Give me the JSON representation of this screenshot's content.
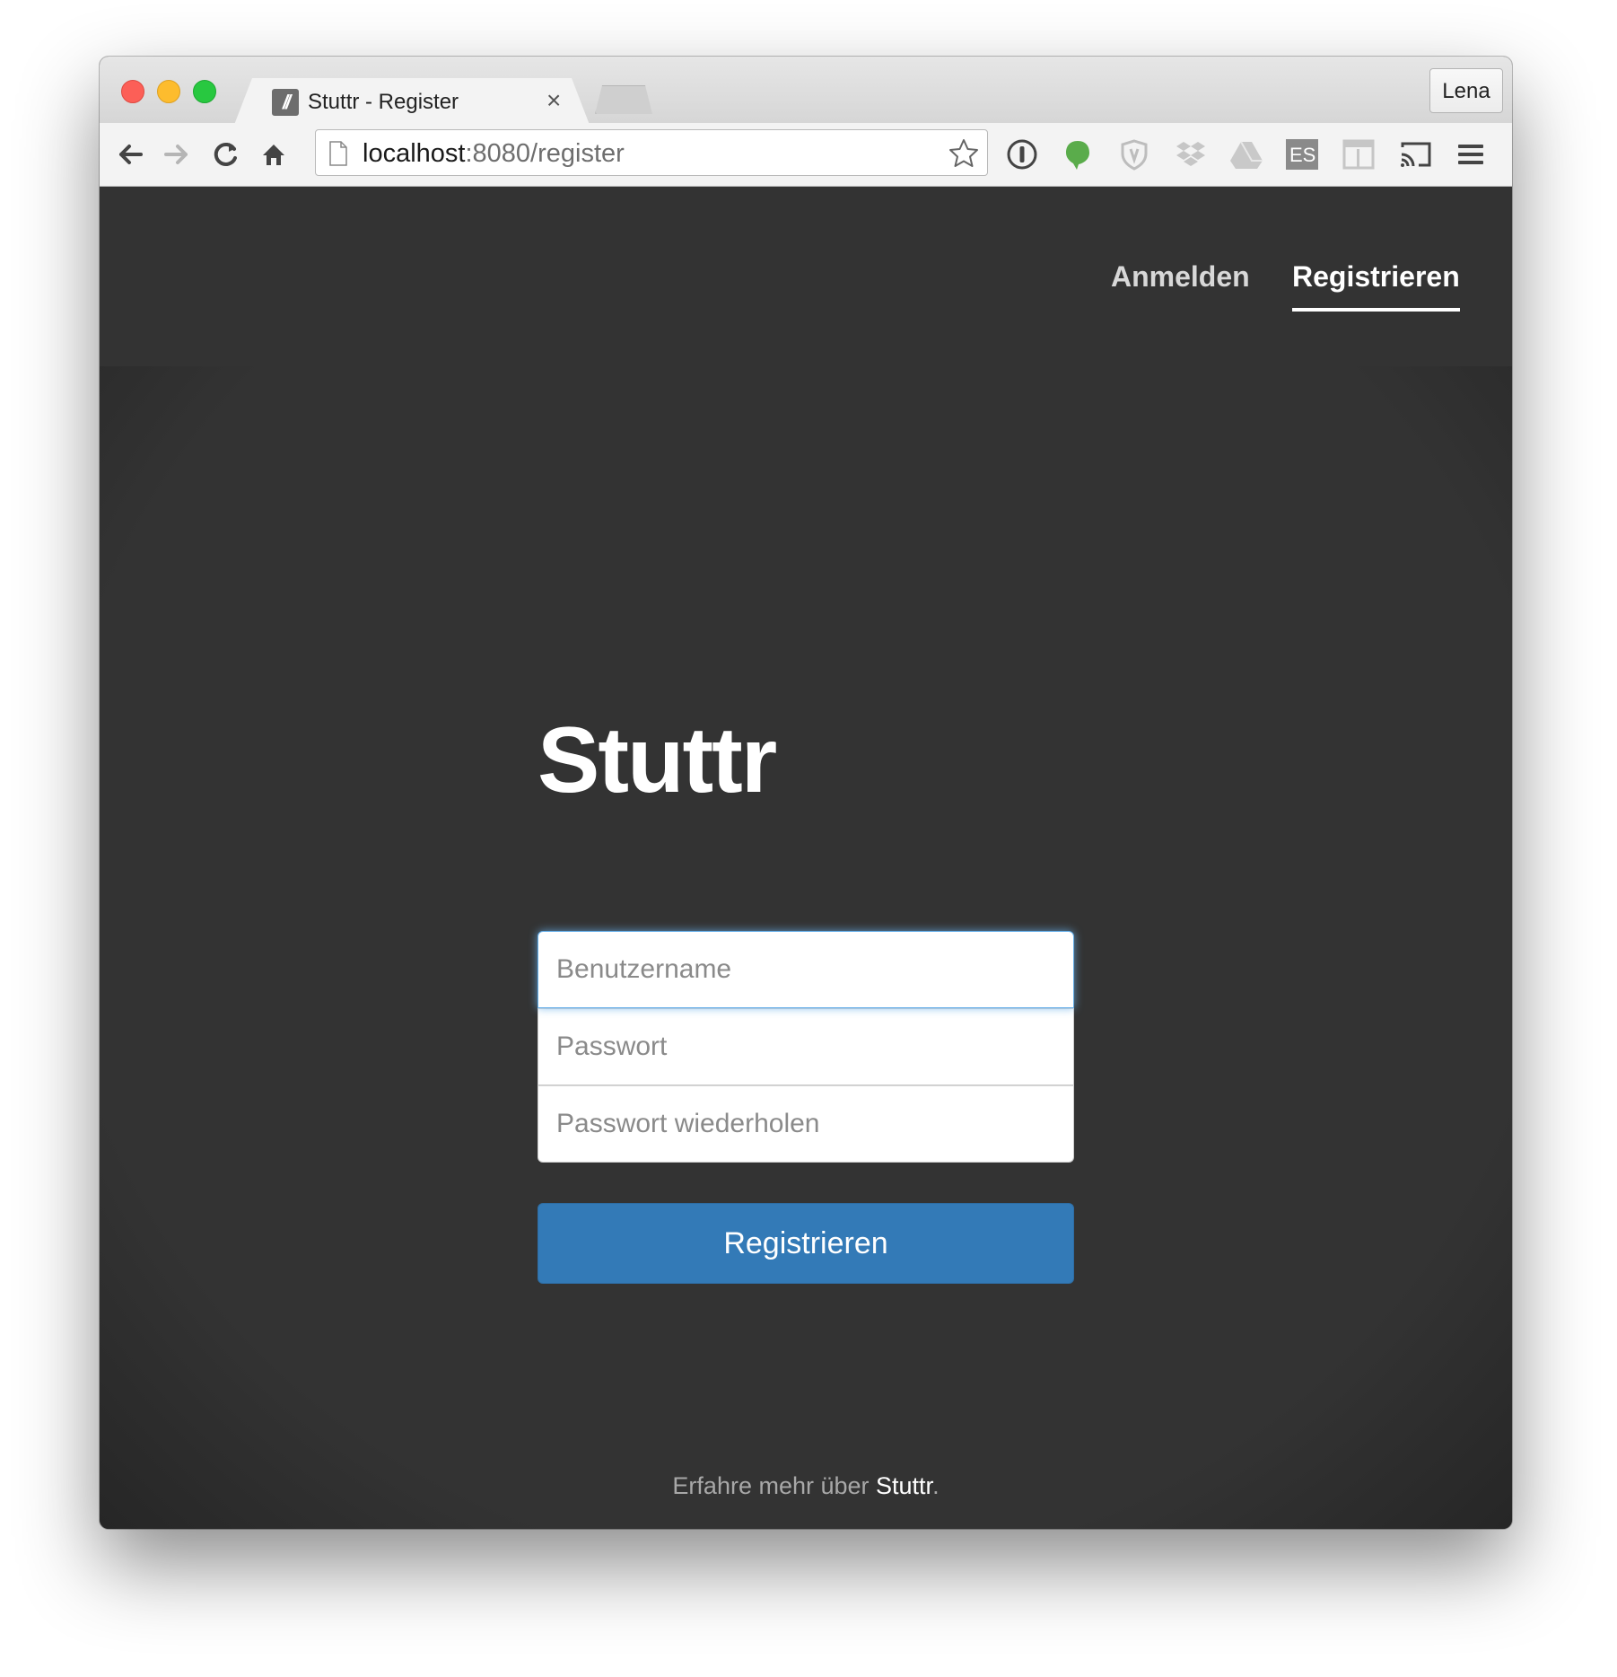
{
  "browser": {
    "tab_title": "Stuttr - Register",
    "tab_favicon_text": "//",
    "tab_close": "×",
    "profile_name": "Lena",
    "url_host": "localhost",
    "url_rest": ":8080/register",
    "toolbar_icons": [
      "back-arrow-icon",
      "forward-arrow-icon",
      "reload-icon",
      "home-icon",
      "page-icon",
      "star-icon",
      "1password-icon",
      "evernote-icon",
      "shield-icon",
      "dropbox-icon",
      "drive-icon",
      "es-icon",
      "layout-icon",
      "cast-icon",
      "menu-icon"
    ],
    "es_label": "ES"
  },
  "nav": {
    "login_label": "Anmelden",
    "register_label": "Registrieren"
  },
  "main": {
    "brand": "Stuttr",
    "username_placeholder": "Benutzername",
    "password_placeholder": "Passwort",
    "password_repeat_placeholder": "Passwort wiederholen",
    "submit_label": "Registrieren"
  },
  "footer": {
    "text_before": "Erfahre mehr über ",
    "link_label": "Stuttr",
    "text_after": "."
  },
  "colors": {
    "primary_button": "#337ab7",
    "page_background": "#333333",
    "focus_border": "#66afe9"
  }
}
